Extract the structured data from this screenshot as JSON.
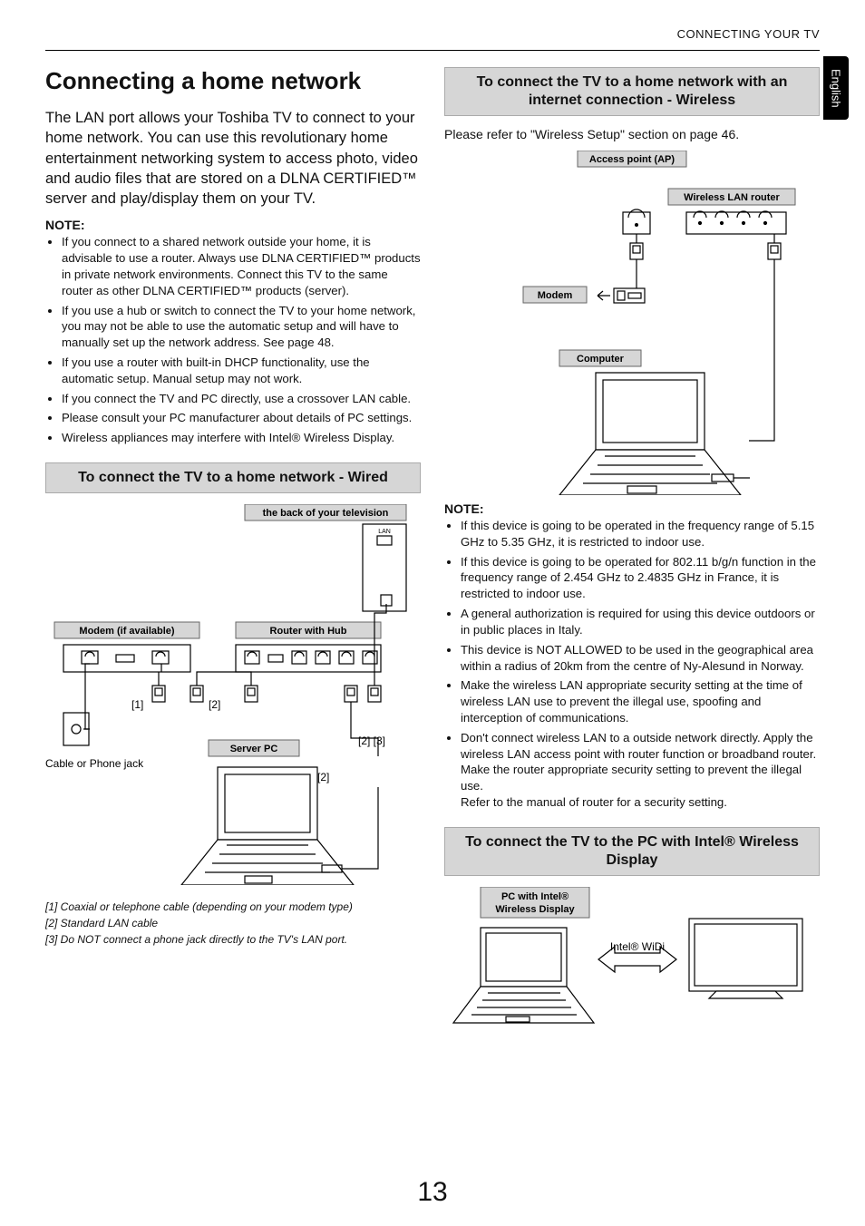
{
  "header": {
    "section": "CONNECTING YOUR TV",
    "lang_tab": "English"
  },
  "left": {
    "h1": "Connecting a home network",
    "intro": "The LAN port allows your Toshiba TV to connect to your home network. You can use this revolutionary home entertainment networking system to access photo, video and audio files that are stored on a DLNA CERTIFIED™ server and play/display them on your TV.",
    "note_head": "NOTE:",
    "notes": [
      "If you connect to a shared network outside your home, it is advisable to use a router. Always use DLNA CERTIFIED™ products in private network environments. Connect this TV to the same router as other DLNA CERTIFIED™ products (server).",
      "If you use a hub or switch to connect the TV to your home network, you may not be able to use the automatic setup and will have to manually set up the network address. See page 48.",
      "If you use a router with built-in DHCP functionality, use the automatic setup. Manual setup may not work.",
      "If you connect the TV and PC directly, use a crossover LAN cable.",
      "Please consult your PC manufacturer about details of PC settings.",
      "Wireless appliances may interfere with Intel® Wireless Display."
    ],
    "section_wired": "To connect the TV to a home network - Wired",
    "diag_wired": {
      "tv_back": "the back of your television",
      "modem": "Modem (if available)",
      "router": "Router with Hub",
      "server": "Server PC",
      "cable_jack": "Cable or Phone jack",
      "n1": "[1]",
      "n2": "[2]",
      "n23": "[2] [3]"
    },
    "footnotes": [
      "[1] Coaxial or telephone cable (depending on your modem type)",
      "[2] Standard LAN cable",
      "[3] Do NOT connect a phone jack directly to the TV's LAN port."
    ]
  },
  "right": {
    "section_wireless": "To connect the TV to a home network with an internet connection - Wireless",
    "ref": "Please refer to \"Wireless Setup\" section on page 46.",
    "diag_wireless": {
      "ap": "Access point (AP)",
      "wlan": "Wireless LAN router",
      "modem": "Modem",
      "computer": "Computer"
    },
    "note_head": "NOTE:",
    "notes": [
      "If this device is going to be operated in the frequency range of 5.15 GHz to 5.35 GHz, it is restricted to indoor use.",
      "If this device is going to be operated for 802.11 b/g/n function in the frequency range of 2.454 GHz to 2.4835 GHz in France, it is restricted to indoor use.",
      "A general authorization is required for using this device outdoors or in public places in Italy.",
      "This device is NOT ALLOWED to be used in the geographical area within a radius of 20km from the centre of Ny-Alesund in Norway.",
      "Make the wireless LAN appropriate security setting at the time of  wireless LAN use to prevent the illegal use, spoofing and interception of communications.",
      "Don't connect wireless LAN to a outside network directly. Apply the wireless LAN access point with router function or broadband router. Make the router appropriate security setting to prevent  the illegal use.\nRefer to the manual of router for a security setting."
    ],
    "section_widi": "To connect the TV to the PC with Intel® Wireless Display",
    "diag_widi": {
      "pc_label": "PC with Intel® Wireless Display",
      "widi": "Intel® WiDi"
    }
  },
  "page_number": "13"
}
